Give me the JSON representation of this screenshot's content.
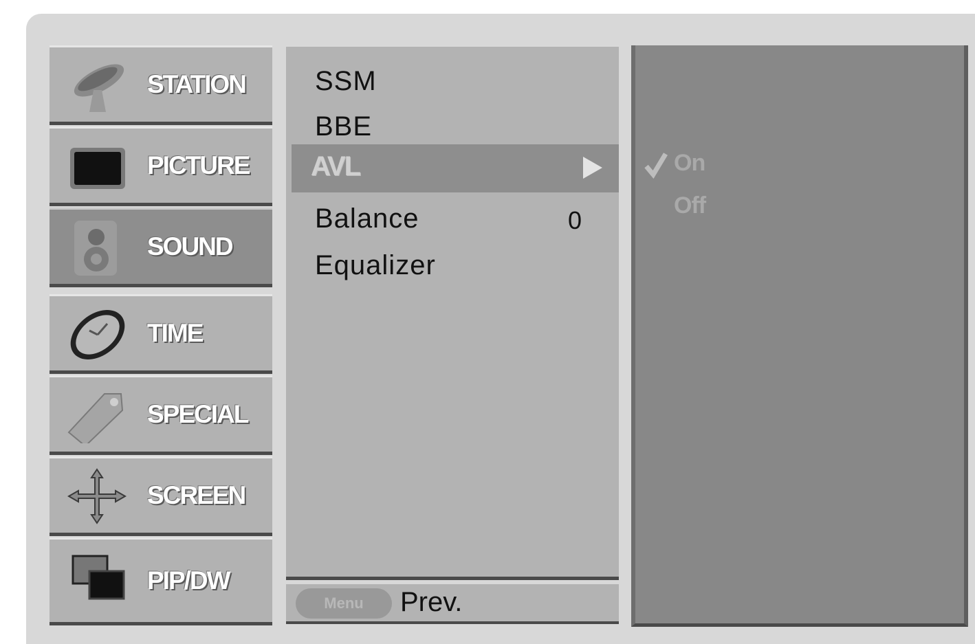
{
  "categories": [
    {
      "label": "STATION",
      "icon": "satellite-dish-icon",
      "active": false
    },
    {
      "label": "PICTURE",
      "icon": "tv-screen-icon",
      "active": false
    },
    {
      "label": "SOUND",
      "icon": "speaker-icon",
      "active": true
    },
    {
      "label": "TIME",
      "icon": "clock-icon",
      "active": false
    },
    {
      "label": "SPECIAL",
      "icon": "tag-icon",
      "active": false
    },
    {
      "label": "SCREEN",
      "icon": "move-arrows-icon",
      "active": false
    },
    {
      "label": "PIP/DW",
      "icon": "pip-windows-icon",
      "active": false
    }
  ],
  "sound_menu": {
    "items": [
      {
        "label": "SSM"
      },
      {
        "label": "BBE"
      },
      {
        "label": "AVL",
        "selected": true
      },
      {
        "label": "Balance",
        "value": "0"
      },
      {
        "label": "Equalizer"
      }
    ]
  },
  "footer": {
    "menu_button": "Menu",
    "prev_label": "Prev."
  },
  "avl_options": [
    {
      "label": "On",
      "checked": true
    },
    {
      "label": "Off",
      "checked": false
    }
  ],
  "colors": {
    "frame": "#d8d8d8",
    "panel": "#b3b3b3",
    "highlight": "#8e8e8e",
    "option_panel": "#888888"
  }
}
